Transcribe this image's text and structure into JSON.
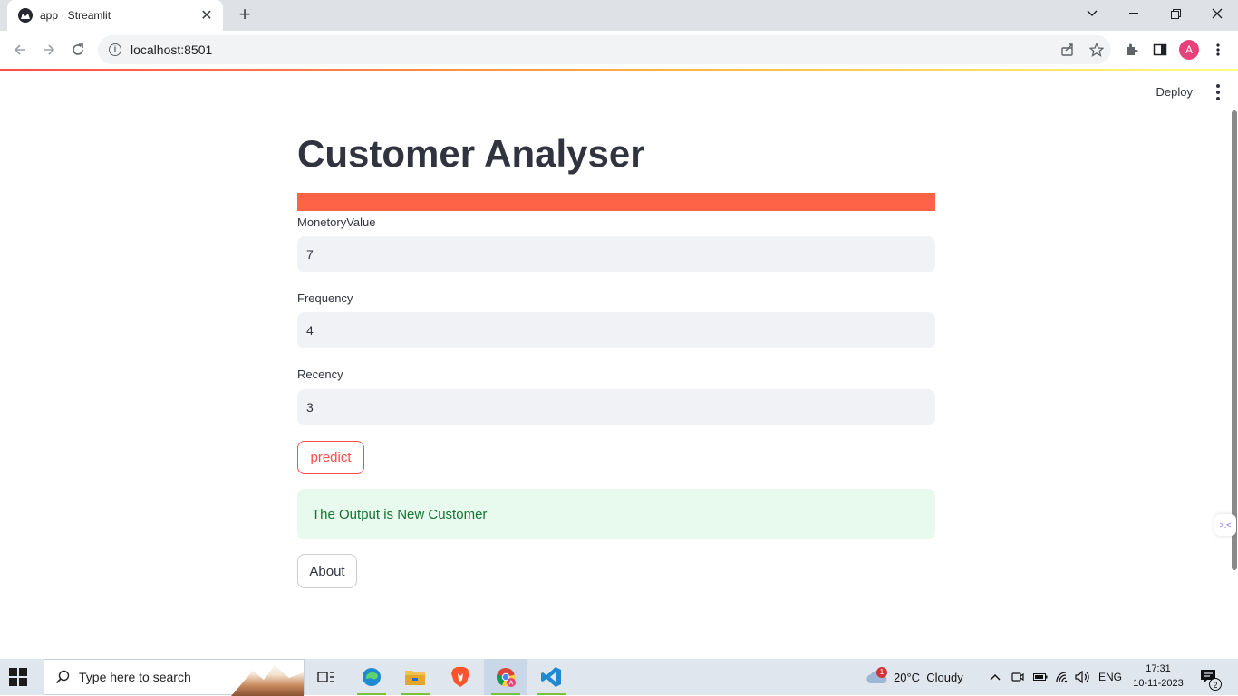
{
  "browser": {
    "tab_title": "app · Streamlit",
    "tab_close": "✕",
    "new_tab": "+",
    "url": "localhost:8501",
    "window_controls": [
      "minimize",
      "restore",
      "close"
    ]
  },
  "app_header": {
    "deploy_label": "Deploy"
  },
  "main": {
    "title": "Customer Analyser",
    "banner_color": "#ff6347",
    "fields": [
      {
        "label": "MonetoryValue",
        "value": "7"
      },
      {
        "label": "Frequency",
        "value": "4"
      },
      {
        "label": "Recency",
        "value": "3"
      }
    ],
    "predict_label": "predict",
    "result_text": "The Output is New Customer",
    "about_label": "About"
  },
  "taskbar": {
    "search_placeholder": "Type here to search",
    "weather_badge": "1",
    "weather_text": "20°C  Cloudy",
    "language": "ENG",
    "time": "17:31",
    "date": "10-11-2023",
    "notification_count": "2"
  },
  "colors": {
    "accent": "#ff4b4b",
    "success_bg": "#e8f9ee",
    "success_text": "#177233",
    "text": "#31333f"
  }
}
